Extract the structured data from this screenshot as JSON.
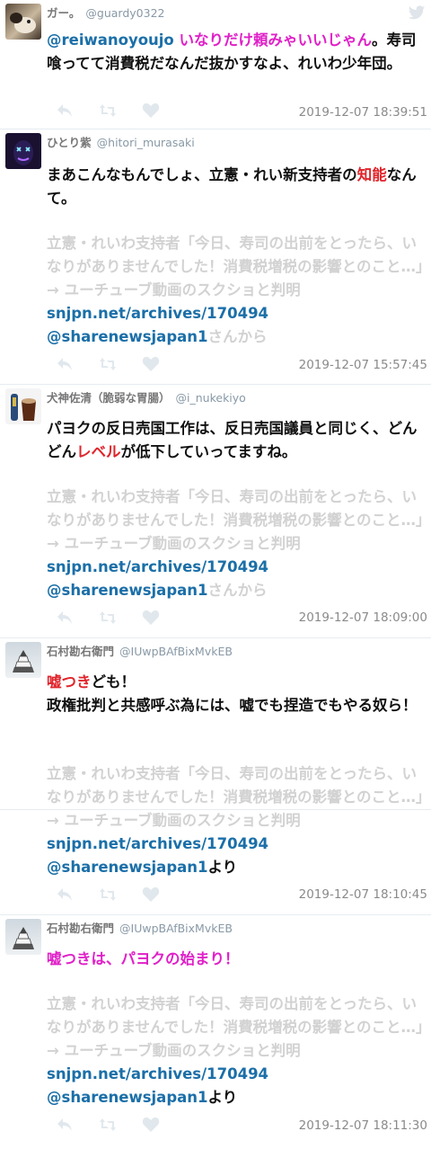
{
  "tweets": [
    {
      "name": "ガー。",
      "handle": "@guardy0322",
      "text_mention": "@reiwanoyoujo",
      "text_mag": "いなりだけ頼みゃいいじゃん",
      "text_rest": "。寿司喰ってて消費税だなんだ抜かすなよ、れいわ少年団。",
      "timestamp": "2019-12-07 18:39:51"
    },
    {
      "name": "ひとり紫",
      "handle": "@hitori_murasaki",
      "text_a": "まあこんなもんでしょ、立憲・れい新支持者の",
      "text_red": "知能",
      "text_b": "なんて。",
      "quote": "立憲・れいわ支持者「今日、寿司の出前をとったら、いなりがありませんでした！消費税増税の影響とのこと…」→ ユーチューブ動画のスクショと判明",
      "link_url": "snjpn.net/archives/170494",
      "link_handle": "@sharenewsjapan1",
      "link_tail": "さんから",
      "timestamp": "2019-12-07 15:57:45"
    },
    {
      "name": "犬神佐清（脆弱な胃腸）",
      "handle": "@i_nukekiyo",
      "text_a": "パヨクの反日売国工作は、反日売国議員と同じく、どんどん",
      "text_red": "レベル",
      "text_b": "が低下していってますね。",
      "quote": "立憲・れいわ支持者「今日、寿司の出前をとったら、いなりがありませんでした！消費税増税の影響とのこと…」→ ユーチューブ動画のスクショと判明",
      "link_url": "snjpn.net/archives/170494",
      "link_handle": "@sharenewsjapan1",
      "link_tail": "さんから",
      "timestamp": "2019-12-07 18:09:00"
    },
    {
      "name": "石村勘右衛門",
      "handle": "@IUwpBAfBixMvkEB",
      "text_red": "嘘つき",
      "text_a": "ども！",
      "text_b": "政権批判と共感呼ぶ為には、嘘でも捏造でもやる奴ら！",
      "quote": "立憲・れいわ支持者「今日、寿司の出前をとったら、いなりがありませんでした！消費税増税の影響とのこと…」→ ユーチューブ動画のスクショと判明",
      "link_url": "snjpn.net/archives/170494",
      "link_handle": "@sharenewsjapan1",
      "link_tail": "より",
      "timestamp": "2019-12-07 18:10:45"
    },
    {
      "name": "石村勘右衛門",
      "handle": "@IUwpBAfBixMvkEB",
      "text_mag": "嘘つきは、パヨクの始まり！",
      "quote": "立憲・れいわ支持者「今日、寿司の出前をとったら、いなりがありませんでした！消費税増税の影響とのこと…」→ ユーチューブ動画のスクショと判明",
      "link_url": "snjpn.net/archives/170494",
      "link_handle": "@sharenewsjapan1",
      "link_tail": "より",
      "timestamp": "2019-12-07 18:11:30"
    }
  ],
  "colors": {
    "accent_magenta": "#e020c8",
    "accent_red": "#e0242a",
    "link": "#1b6fa8",
    "quote_gray": "#d2d2d2"
  },
  "icons": [
    "reply-icon",
    "retweet-icon",
    "like-icon",
    "twitter-bird-icon"
  ]
}
